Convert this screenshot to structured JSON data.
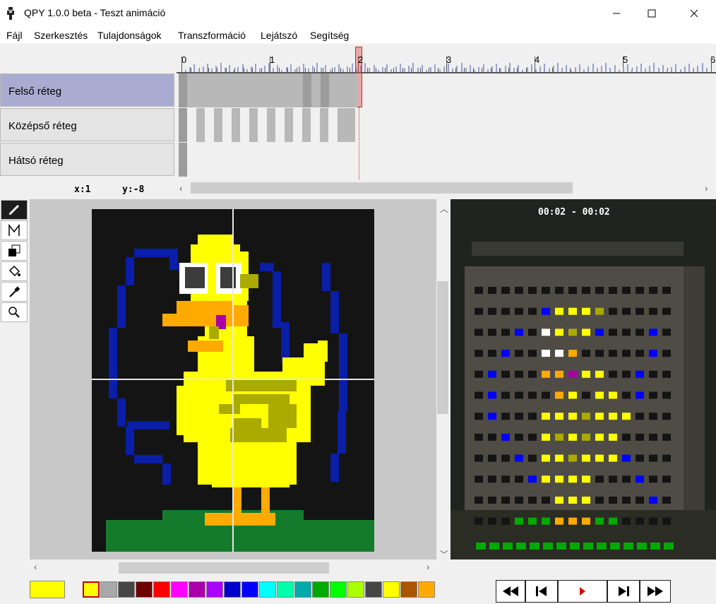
{
  "window": {
    "title": "QPY 1.0.0 beta - Teszt animáció"
  },
  "menu": [
    "Fájl",
    "Szerkesztés",
    "Tulajdonságok",
    "Transzformáció",
    "Lejátszó",
    "Segítség"
  ],
  "layers": [
    {
      "label": "Felső réteg",
      "selected": true
    },
    {
      "label": "Középső réteg",
      "selected": false
    },
    {
      "label": "Hátsó réteg",
      "selected": false
    }
  ],
  "ruler": {
    "labels": [
      "0",
      "1",
      "2",
      "3",
      "4",
      "5",
      "6"
    ],
    "current": "2"
  },
  "status": {
    "x": "x:1",
    "y": "y:-8"
  },
  "tools": [
    "pencil-icon",
    "polyline-icon",
    "layer-copy-icon",
    "fill-bucket-icon",
    "eyedropper-icon",
    "zoom-icon"
  ],
  "preview": {
    "time": "00:02 - 00:02"
  },
  "palette": {
    "current": "#ffff00",
    "colors": [
      "#ffff00",
      "#a8a8a8",
      "#464646",
      "#6e0000",
      "#ff0000",
      "#ff00ff",
      "#aa00aa",
      "#aa00ff",
      "#0000cc",
      "#0000ff",
      "#00ffff",
      "#00ffaa",
      "#00aaaa",
      "#00aa00",
      "#00ff00",
      "#aaff00",
      "#464646",
      "#ffff00",
      "#aa5500",
      "#ffaa00"
    ]
  },
  "player": [
    "rewind-icon",
    "prev-frame-icon",
    "play-icon",
    "next-frame-icon",
    "fast-forward-icon"
  ]
}
